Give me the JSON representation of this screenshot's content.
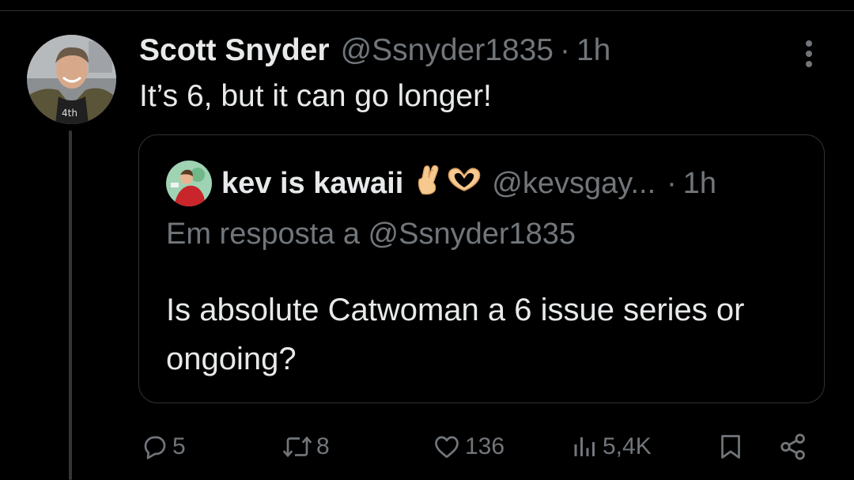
{
  "post": {
    "author_name": "Scott Snyder",
    "author_handle": "@Ssnyder1835",
    "separator": "·",
    "time": "1h",
    "text": "It’s 6, but it can go longer!",
    "more_icon": "more-vertical-icon"
  },
  "quote": {
    "author_name": "kev is kawaii",
    "emojis": [
      "crossed-fingers-icon",
      "heart-hands-icon"
    ],
    "author_handle": "@kevsgay...",
    "separator": "·",
    "time": "1h",
    "reply_to": "Em resposta a @Ssnyder1835",
    "text": "Is absolute Catwoman a 6 issue series or ongoing?"
  },
  "actions": {
    "replies": {
      "icon": "reply-icon",
      "count": "5"
    },
    "reposts": {
      "icon": "repost-icon",
      "count": "8"
    },
    "likes": {
      "icon": "heart-icon",
      "count": "136"
    },
    "views": {
      "icon": "views-icon",
      "count": "5,4K"
    },
    "bookmark": {
      "icon": "bookmark-icon"
    },
    "share": {
      "icon": "share-icon"
    }
  },
  "colors": {
    "background": "#000000",
    "text_primary": "#e7e9ea",
    "text_secondary": "#71767b",
    "border": "#2f3336"
  }
}
